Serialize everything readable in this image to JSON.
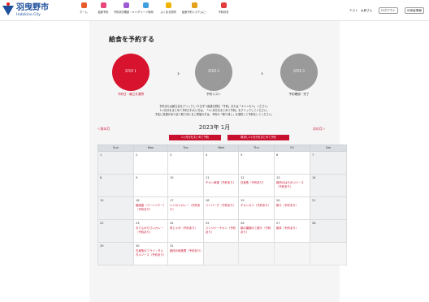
{
  "header": {
    "logo": {
      "name_jp": "羽曳野市",
      "name_en": "Habikino City"
    },
    "nav": [
      {
        "label": "ホーム",
        "icon": "home-icon",
        "color": "#e85c2a"
      },
      {
        "label": "給食予約",
        "icon": "meal-icon",
        "color": "#e8477a"
      },
      {
        "label": "予約状況確認・キャンセル",
        "icon": "calendar-check-icon",
        "color": "#9c5bd1"
      },
      {
        "label": "チャージ利用",
        "icon": "charge-icon",
        "color": "#3fa0e0"
      },
      {
        "label": "よくある質問",
        "icon": "question-icon",
        "color": "#f0b400"
      },
      {
        "label": "給食予約システムについて",
        "icon": "info-icon",
        "color": "#e2a01c"
      },
      {
        "label": "予約状況",
        "icon": "status-icon",
        "color": "#e23b3b"
      }
    ],
    "user_prefix": "テスト",
    "user_name": "太郎さん",
    "logout_label": "ログアウト",
    "settings_label": "利用者情報"
  },
  "page": {
    "title": "給食を予約する",
    "steps": [
      {
        "num": "STEP 1",
        "label": "予約日・献立を選択",
        "active": true
      },
      {
        "num": "STEP 2",
        "label": "予約リスト",
        "active": false
      },
      {
        "num": "STEP 3",
        "label": "予約確認・完了",
        "active": false
      }
    ],
    "notice": [
      "予約または献立名をクリックして1日ずつ給食日程を「予約」または「キャンセル」ください。",
      "1ヶ月分をまとめて予約されたい方は、「1ヶ月分をまとめて予約」をクリックしてください。",
      "予定に変更があり全て取り消しをご希望の方は、予約の「取り消し」を選択して予約をしてください。"
    ],
    "prev_month": "＜前の月",
    "next_month": "次の月＞",
    "month_title": "2023年 1月",
    "bulk_reserve": "1ヶ月分をまとめて予約",
    "bulk_cancel": "取消し1ヶ月分をまとめて予約"
  },
  "calendar": {
    "weekdays": [
      "Sun",
      "Mon",
      "Tue",
      "Wed",
      "Thu",
      "Fri",
      "Sat"
    ],
    "weeks": [
      [
        {
          "day": "1"
        },
        {
          "day": "2"
        },
        {
          "day": "3"
        },
        {
          "day": "4"
        },
        {
          "day": "5"
        },
        {
          "day": "6"
        },
        {
          "day": "7"
        }
      ],
      [
        {
          "day": "8"
        },
        {
          "day": "9"
        },
        {
          "day": "10"
        },
        {
          "day": "11",
          "menu": "チキン南蛮（予約あり）"
        },
        {
          "day": "12",
          "menu": "白身魚（予約あり）"
        },
        {
          "day": "13",
          "menu": "鶏肉のはちみつソース（予約あり）"
        },
        {
          "day": "14"
        }
      ],
      [
        {
          "day": "15"
        },
        {
          "day": "16",
          "menu": "鮭南蛮（コーンソテー）（予約あり）"
        },
        {
          "day": "17",
          "menu": "レバカツカレー（予約あり）"
        },
        {
          "day": "18",
          "menu": "ハンバーグ（予約あり）"
        },
        {
          "day": "19",
          "menu": "チキンカツ（予約あり）"
        },
        {
          "day": "20",
          "menu": "豚汁（予約あり）"
        },
        {
          "day": "21"
        }
      ],
      [
        {
          "day": "22"
        },
        {
          "day": "23",
          "menu": "おでんのやさいカレー（予約あり）"
        },
        {
          "day": "24",
          "menu": "肉じゃが（予約あり）"
        },
        {
          "day": "25",
          "menu": "ジンジャーチキン（予約あり）"
        },
        {
          "day": "26",
          "menu": "鶏の唐揚げと豚汁（予約あり）"
        },
        {
          "day": "27",
          "menu": "豚丼（予約あり）"
        },
        {
          "day": "28"
        }
      ],
      [
        {
          "day": "29"
        },
        {
          "day": "30",
          "menu": "白身魚のフライ・タルタルソース（予約あり）"
        },
        {
          "day": "31",
          "menu": "鶏肉の和風煮（予約あり）"
        },
        {
          "day": ""
        },
        {
          "day": ""
        },
        {
          "day": ""
        },
        {
          "day": ""
        }
      ]
    ]
  },
  "colors": {
    "accent": "#c8102e",
    "step_active": "#d7132d",
    "step_inactive": "#9a9a9a",
    "brand_blue": "#1d4f9c"
  }
}
